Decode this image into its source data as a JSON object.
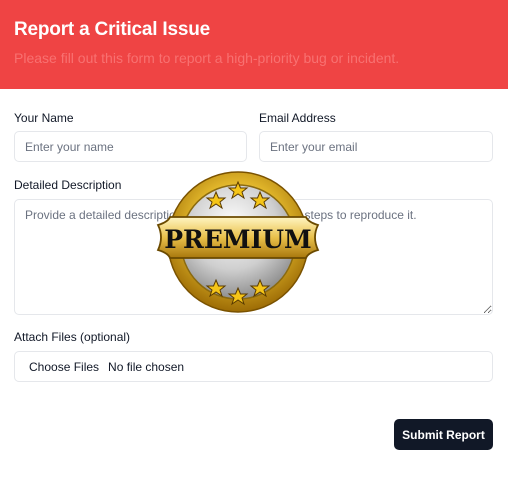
{
  "header": {
    "title": "Report a Critical Issue",
    "subtitle": "Please fill out this form to report a high-priority bug or incident."
  },
  "form": {
    "name": {
      "label": "Your Name",
      "placeholder": "Enter your name"
    },
    "email": {
      "label": "Email Address",
      "placeholder": "Enter your email"
    },
    "description": {
      "label": "Detailed Description",
      "placeholder": "Provide a detailed description of the issue, including steps to reproduce it."
    },
    "attachments": {
      "label": "Attach Files (optional)",
      "button_label": "Choose Files",
      "status": "No file chosen"
    },
    "submit_label": "Submit Report"
  },
  "overlay_badge": {
    "text": "PREMIUM",
    "icon": "premium-badge-icon",
    "colors": {
      "gold": "#d4a017",
      "silver": "#c8c8c8",
      "text": "#111111"
    }
  },
  "colors": {
    "header_bg": "#ef4444",
    "button_bg": "#111827"
  }
}
